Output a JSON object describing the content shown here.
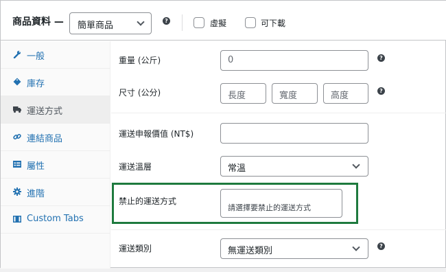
{
  "header": {
    "title": "商品資料 —",
    "product_type": "簡單商品",
    "virtual_label": "虛擬",
    "downloadable_label": "可下載"
  },
  "sidebar": {
    "items": [
      {
        "label": "一般",
        "icon": "wrench-icon",
        "active": false
      },
      {
        "label": "庫存",
        "icon": "tag-icon",
        "active": false
      },
      {
        "label": "運送方式",
        "icon": "truck-icon",
        "active": true
      },
      {
        "label": "連結商品",
        "icon": "link-icon",
        "active": false
      },
      {
        "label": "屬性",
        "icon": "list-icon",
        "active": false
      },
      {
        "label": "進階",
        "icon": "gear-icon",
        "active": false
      },
      {
        "label": "Custom Tabs",
        "icon": "table-icon",
        "active": false
      }
    ]
  },
  "shipping": {
    "weight_label": "重量 (公斤)",
    "weight_placeholder": "0",
    "dimensions_label": "尺寸 (公分)",
    "length_placeholder": "長度",
    "width_placeholder": "寬度",
    "height_placeholder": "高度",
    "declared_value_label": "運送申報價值 (NT$)",
    "declared_value": "",
    "temperature_label": "運送溫層",
    "temperature_value": "常溫",
    "forbidden_methods_label": "禁止的運送方式",
    "forbidden_methods_placeholder": "請選擇要禁止的運送方式",
    "shipping_class_label": "運送類別",
    "shipping_class_value": "無運送類別"
  },
  "colors": {
    "link": "#2271b1",
    "highlight_border": "#1e7a3e",
    "active_tab_bg": "#eeeeee"
  }
}
